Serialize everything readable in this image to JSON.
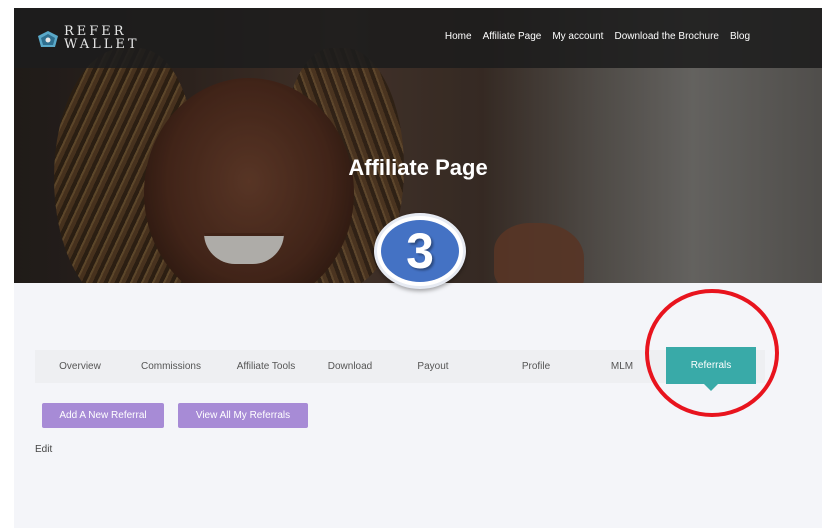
{
  "logo": {
    "line1": "REFER",
    "line2": "WALLET"
  },
  "nav": {
    "items": [
      "Home",
      "Affiliate Page",
      "My account",
      "Download the Brochure",
      "Blog"
    ]
  },
  "hero": {
    "title": "Affiliate Page"
  },
  "step_badge": {
    "number": "3",
    "color": "#4472c4"
  },
  "tabs": {
    "items": [
      "Overview",
      "Commissions",
      "Affiliate Tools",
      "Download",
      "Payout",
      "Profile",
      "MLM",
      "Referrals"
    ],
    "active": "Referrals",
    "active_color": "#39aaa8"
  },
  "actions": {
    "add_label": "Add A New Referral",
    "view_label": "View All My Referrals",
    "button_color": "#a78bd6"
  },
  "content": {
    "edit_label": "Edit"
  },
  "annotation": {
    "circle_color": "#e8141e"
  }
}
